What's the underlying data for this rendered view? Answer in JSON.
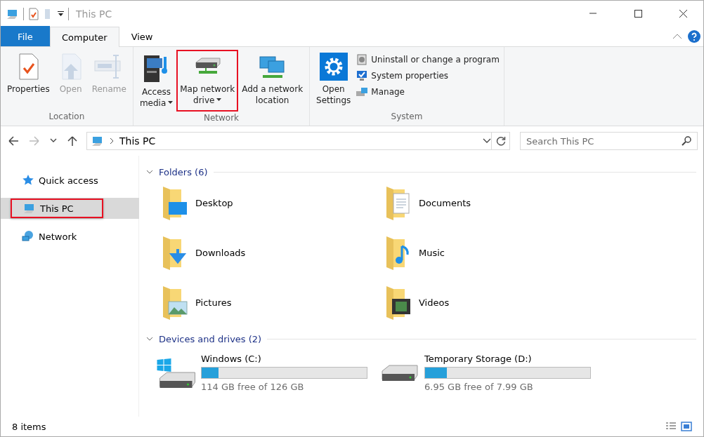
{
  "window": {
    "title": "This PC"
  },
  "tabs": [
    {
      "label": "File",
      "kind": "file",
      "selected": false
    },
    {
      "label": "Computer",
      "kind": "tab",
      "selected": true
    },
    {
      "label": "View",
      "kind": "tab",
      "selected": false
    }
  ],
  "ribbon": {
    "groups": [
      {
        "label": "Location",
        "items": [
          {
            "label": "Properties",
            "disabled": false,
            "dropdown": false,
            "highlighted": false
          },
          {
            "label": "Open",
            "disabled": true,
            "dropdown": false,
            "highlighted": false
          },
          {
            "label": "Rename",
            "disabled": true,
            "dropdown": false,
            "highlighted": false
          }
        ]
      },
      {
        "label": "Network",
        "items": [
          {
            "label": "Access media",
            "disabled": false,
            "dropdown": true,
            "highlighted": false
          },
          {
            "label": "Map network drive",
            "disabled": false,
            "dropdown": true,
            "highlighted": true
          },
          {
            "label": "Add a network location",
            "disabled": false,
            "dropdown": false,
            "highlighted": false
          }
        ]
      },
      {
        "label": "System",
        "items": [
          {
            "label": "Open Settings",
            "disabled": false,
            "dropdown": false,
            "highlighted": false
          }
        ],
        "commands": [
          {
            "label": "Uninstall or change a program"
          },
          {
            "label": "System properties"
          },
          {
            "label": "Manage"
          }
        ]
      }
    ]
  },
  "address_bar": {
    "path": "This PC"
  },
  "search": {
    "placeholder": "Search This PC"
  },
  "sidebar": {
    "items": [
      {
        "label": "Quick access",
        "selected": false,
        "highlighted": false
      },
      {
        "label": "This PC",
        "selected": true,
        "highlighted": true
      },
      {
        "label": "Network",
        "selected": false,
        "highlighted": false
      }
    ]
  },
  "folders": {
    "heading": "Folders (6)",
    "expanded": true,
    "items": [
      {
        "label": "Desktop",
        "kind": "desktop"
      },
      {
        "label": "Documents",
        "kind": "documents"
      },
      {
        "label": "Downloads",
        "kind": "downloads"
      },
      {
        "label": "Music",
        "kind": "music"
      },
      {
        "label": "Pictures",
        "kind": "pictures"
      },
      {
        "label": "Videos",
        "kind": "videos"
      }
    ]
  },
  "drives": {
    "heading": "Devices and drives (2)",
    "expanded": true,
    "items": [
      {
        "label": "Windows (C:)",
        "kind": "system",
        "level": 0.1,
        "reading": "114 GB free of 126 GB"
      },
      {
        "label": "Temporary Storage (D:)",
        "kind": "disk",
        "level": 0.13,
        "reading": "6.95 GB free of 7.99 GB"
      }
    ]
  },
  "status_bar": {
    "count": "8 items"
  }
}
